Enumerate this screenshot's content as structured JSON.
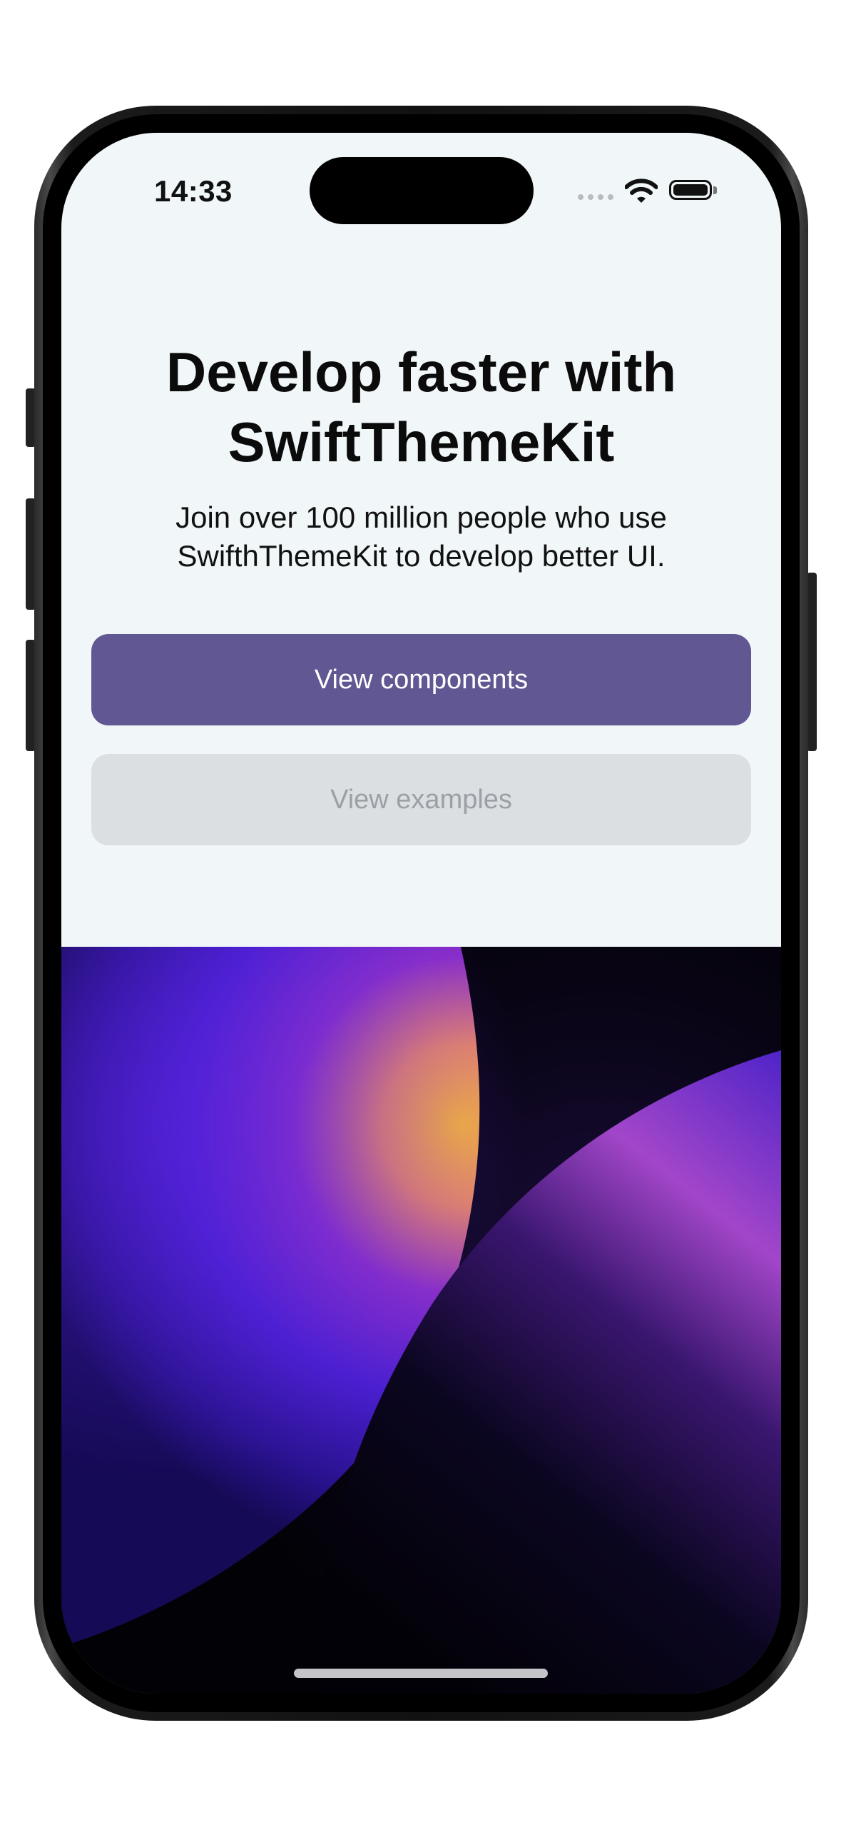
{
  "status_bar": {
    "time": "14:33"
  },
  "hero": {
    "title": "Develop faster with SwiftThemeKit",
    "subtitle": "Join over 100 million people who use SwifthThemeKit to develop better UI."
  },
  "actions": {
    "primary_label": "View components",
    "secondary_label": "View examples"
  },
  "colors": {
    "primary_button": "#615893",
    "secondary_button": "#dbdfe2",
    "screen_background": "#f1f7f9"
  },
  "icons": [
    "cellular-signal-icon",
    "wifi-icon",
    "battery-icon"
  ]
}
